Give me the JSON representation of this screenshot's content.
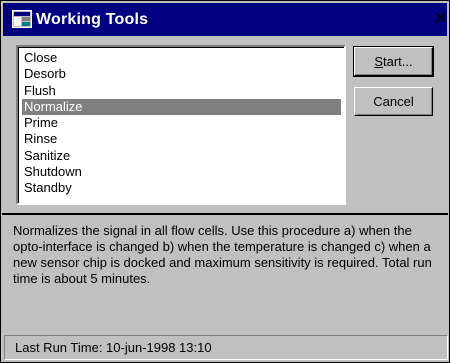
{
  "window": {
    "title": "Working Tools",
    "close_glyph": "✕",
    "icon": "app-window-icon"
  },
  "list": {
    "items": [
      {
        "label": "Close",
        "selected": false
      },
      {
        "label": "Desorb",
        "selected": false
      },
      {
        "label": "Flush",
        "selected": false
      },
      {
        "label": "Normalize",
        "selected": true
      },
      {
        "label": "Prime",
        "selected": false
      },
      {
        "label": "Rinse",
        "selected": false
      },
      {
        "label": "Sanitize",
        "selected": false
      },
      {
        "label": "Shutdown",
        "selected": false
      },
      {
        "label": "Standby",
        "selected": false
      }
    ]
  },
  "buttons": {
    "start_mnemonic": "S",
    "start_rest": "tart...",
    "cancel_label": "Cancel"
  },
  "description": "Normalizes the signal in all flow cells. Use this procedure a) when the opto-interface is changed b) when the temperature is changed c) when a new sensor chip is docked and maximum sensitivity is required. Total run time is about 5 minutes.",
  "status": {
    "text": "Last Run Time: 10-jun-1998  13:10"
  },
  "colors": {
    "titlebar": "#000080",
    "face": "#c0c0c0",
    "selection": "#808080"
  }
}
